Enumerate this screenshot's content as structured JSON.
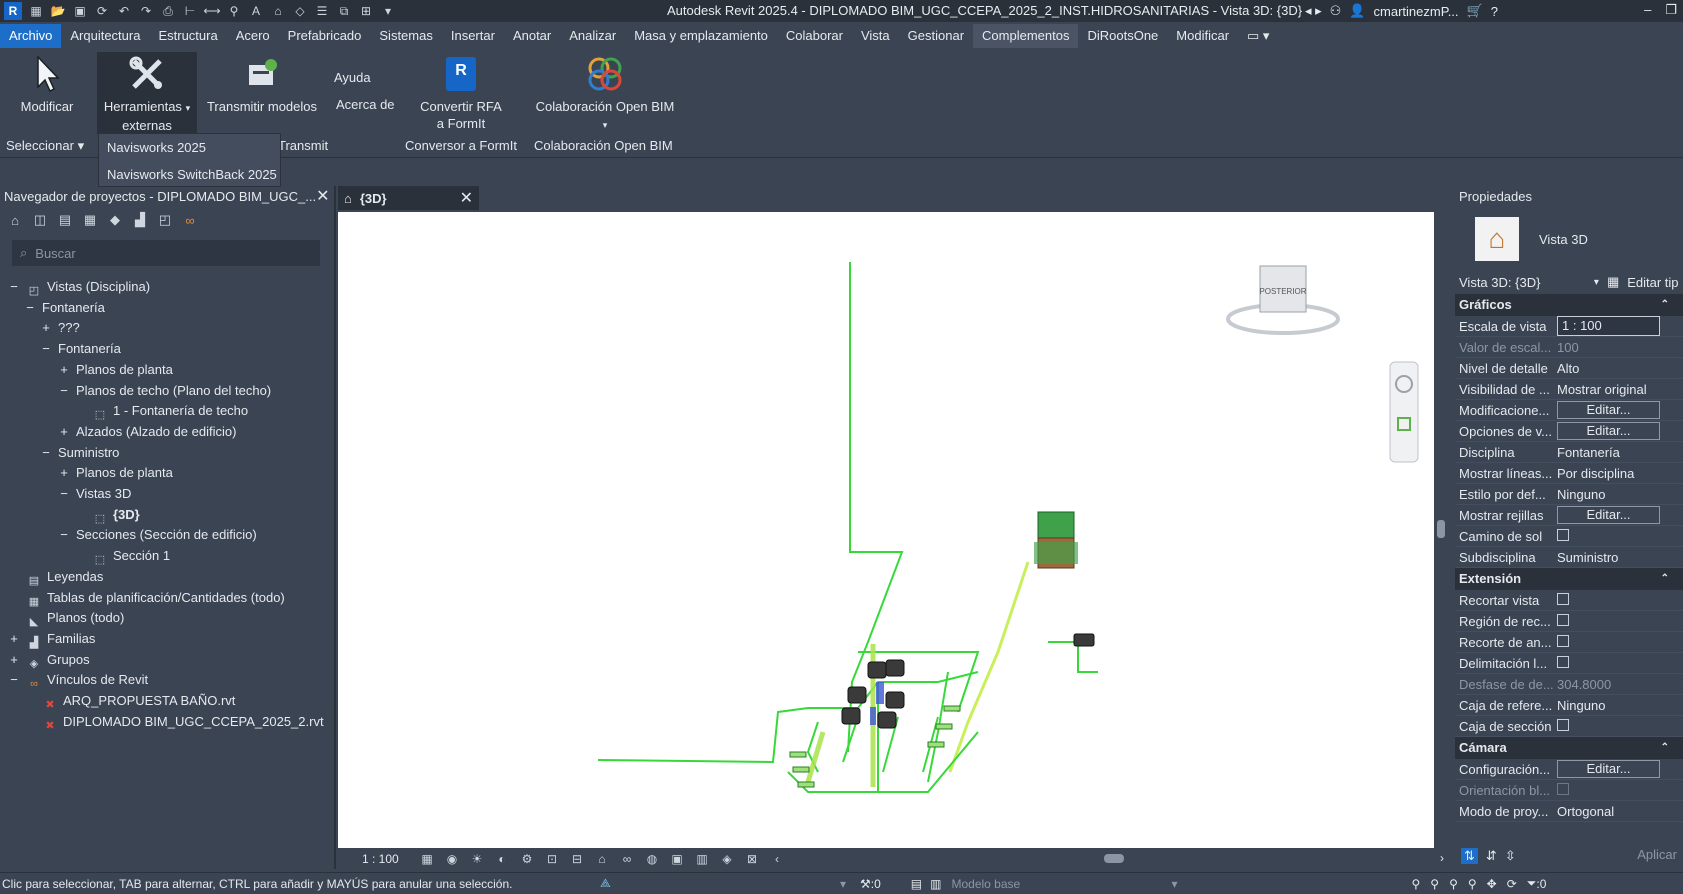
{
  "window": {
    "title": "Autodesk Revit 2025.4 - DIPLOMADO BIM_UGC_CCEPA_2025_2_INST.HIDROSANITARIAS - Vista 3D: {3D}",
    "user": "cmartinezmP..."
  },
  "menu": {
    "tabs": [
      "Archivo",
      "Arquitectura",
      "Estructura",
      "Acero",
      "Prefabricado",
      "Sistemas",
      "Insertar",
      "Anotar",
      "Analizar",
      "Masa y emplazamiento",
      "Colaborar",
      "Vista",
      "Gestionar",
      "Complementos",
      "DiRootsOne",
      "Modificar"
    ],
    "active": "Complementos"
  },
  "ribbon": {
    "modify": "Modificar",
    "ext_tools_1": "Herramientas",
    "ext_tools_2": "externas",
    "transmit": "Transmitir modelos",
    "help": "Ayuda",
    "about": "Acerca de",
    "rfa_1": "Convertir RFA",
    "rfa_2": "a FormIt",
    "openbim": "Colaboración Open BIM",
    "panel_select": "Seleccionar",
    "panel_transmit": "Transmit",
    "panel_formit": "Conversor a FormIt",
    "panel_openbim": "Colaboración Open BIM",
    "dropdown": [
      "Navisworks 2025",
      "Navisworks SwitchBack 2025"
    ]
  },
  "browser": {
    "title": "Navegador de proyectos - DIPLOMADO BIM_UGC_...",
    "search_placeholder": "Buscar",
    "rows": [
      {
        "glyph": "−",
        "icon": "views",
        "label": "Vistas (Disciplina)",
        "indent": 0
      },
      {
        "glyph": "−",
        "icon": "",
        "label": "Fontanería",
        "indent": 1
      },
      {
        "glyph": "+",
        "icon": "",
        "label": "???",
        "indent": 2
      },
      {
        "glyph": "−",
        "icon": "",
        "label": "Fontanería",
        "indent": 2
      },
      {
        "glyph": "+",
        "icon": "",
        "label": "Planos de planta",
        "indent": 3
      },
      {
        "glyph": "−",
        "icon": "",
        "label": "Planos de techo (Plano del techo)",
        "indent": 3
      },
      {
        "glyph": "",
        "icon": "view",
        "label": "1 - Fontanería de techo",
        "indent": 4
      },
      {
        "glyph": "+",
        "icon": "",
        "label": "Alzados (Alzado de edificio)",
        "indent": 3
      },
      {
        "glyph": "−",
        "icon": "",
        "label": "Suministro",
        "indent": 2
      },
      {
        "glyph": "+",
        "icon": "",
        "label": "Planos de planta",
        "indent": 3
      },
      {
        "glyph": "−",
        "icon": "",
        "label": "Vistas 3D",
        "indent": 3
      },
      {
        "glyph": "",
        "icon": "view",
        "label": "{3D}",
        "indent": 4,
        "bold": true
      },
      {
        "glyph": "−",
        "icon": "",
        "label": "Secciones (Sección de edificio)",
        "indent": 3
      },
      {
        "glyph": "",
        "icon": "view",
        "label": "Sección 1",
        "indent": 4
      },
      {
        "glyph": "",
        "icon": "legend",
        "label": "Leyendas",
        "indent": 0
      },
      {
        "glyph": "",
        "icon": "table",
        "label": "Tablas de planificación/Cantidades (todo)",
        "indent": 0
      },
      {
        "glyph": "",
        "icon": "sheet",
        "label": "Planos (todo)",
        "indent": 0
      },
      {
        "glyph": "+",
        "icon": "family",
        "label": "Familias",
        "indent": 0
      },
      {
        "glyph": "+",
        "icon": "group",
        "label": "Grupos",
        "indent": 0
      },
      {
        "glyph": "−",
        "icon": "link",
        "label": "Vínculos de Revit",
        "indent": 0
      },
      {
        "glyph": "",
        "icon": "redx",
        "label": "ARQ_PROPUESTA BAÑO.rvt",
        "indent": 1
      },
      {
        "glyph": "",
        "icon": "redx",
        "label": "DIPLOMADO BIM_UGC_CCEPA_2025_2.rvt",
        "indent": 1
      }
    ]
  },
  "view": {
    "tab": "{3D}",
    "scale": "1 : 100",
    "viewcube_face": "POSTERIOR"
  },
  "properties": {
    "title": "Propiedades",
    "type": "Vista 3D",
    "instance": "Vista 3D: {3D}",
    "edit_type": "Editar tip",
    "groups": [
      {
        "name": "Gráficos",
        "rows": [
          {
            "k": "Escala de vista",
            "v": "1 : 100",
            "kind": "input"
          },
          {
            "k": "Valor de escal...",
            "v": "100",
            "kind": "dis"
          },
          {
            "k": "Nivel de detalle",
            "v": "Alto"
          },
          {
            "k": "Visibilidad de ...",
            "v": "Mostrar original"
          },
          {
            "k": "Modificacione...",
            "v": "Editar...",
            "kind": "btn"
          },
          {
            "k": "Opciones de v...",
            "v": "Editar...",
            "kind": "btn"
          },
          {
            "k": "Disciplina",
            "v": "Fontanería"
          },
          {
            "k": "Mostrar líneas...",
            "v": "Por disciplina"
          },
          {
            "k": "Estilo por def...",
            "v": "Ninguno"
          },
          {
            "k": "Mostrar rejillas",
            "v": "Editar...",
            "kind": "btn"
          },
          {
            "k": "Camino de sol",
            "v": "",
            "kind": "chk"
          },
          {
            "k": "Subdisciplina",
            "v": "Suministro"
          }
        ]
      },
      {
        "name": "Extensión",
        "rows": [
          {
            "k": "Recortar vista",
            "v": "",
            "kind": "chk"
          },
          {
            "k": "Región de rec...",
            "v": "",
            "kind": "chk"
          },
          {
            "k": "Recorte de an...",
            "v": "",
            "kind": "chk"
          },
          {
            "k": "Delimitación l...",
            "v": "",
            "kind": "chk"
          },
          {
            "k": "Desfase de de...",
            "v": "304.8000",
            "kind": "dis"
          },
          {
            "k": "Caja de refere...",
            "v": "Ninguno"
          },
          {
            "k": "Caja de sección",
            "v": "",
            "kind": "chk"
          }
        ]
      },
      {
        "name": "Cámara",
        "rows": [
          {
            "k": "Configuración...",
            "v": "Editar...",
            "kind": "btn"
          },
          {
            "k": "Orientación bl...",
            "v": "",
            "kind": "dischk"
          },
          {
            "k": "Modo de proy...",
            "v": "Ortogonal"
          }
        ]
      }
    ],
    "apply": "Aplicar"
  },
  "status": {
    "message": "Clic para seleccionar, TAB para alternar, CTRL para añadir y MAYÚS para anular una selección.",
    "workset_count": ":0",
    "model": "Modelo base",
    "filter_count": ":0"
  }
}
